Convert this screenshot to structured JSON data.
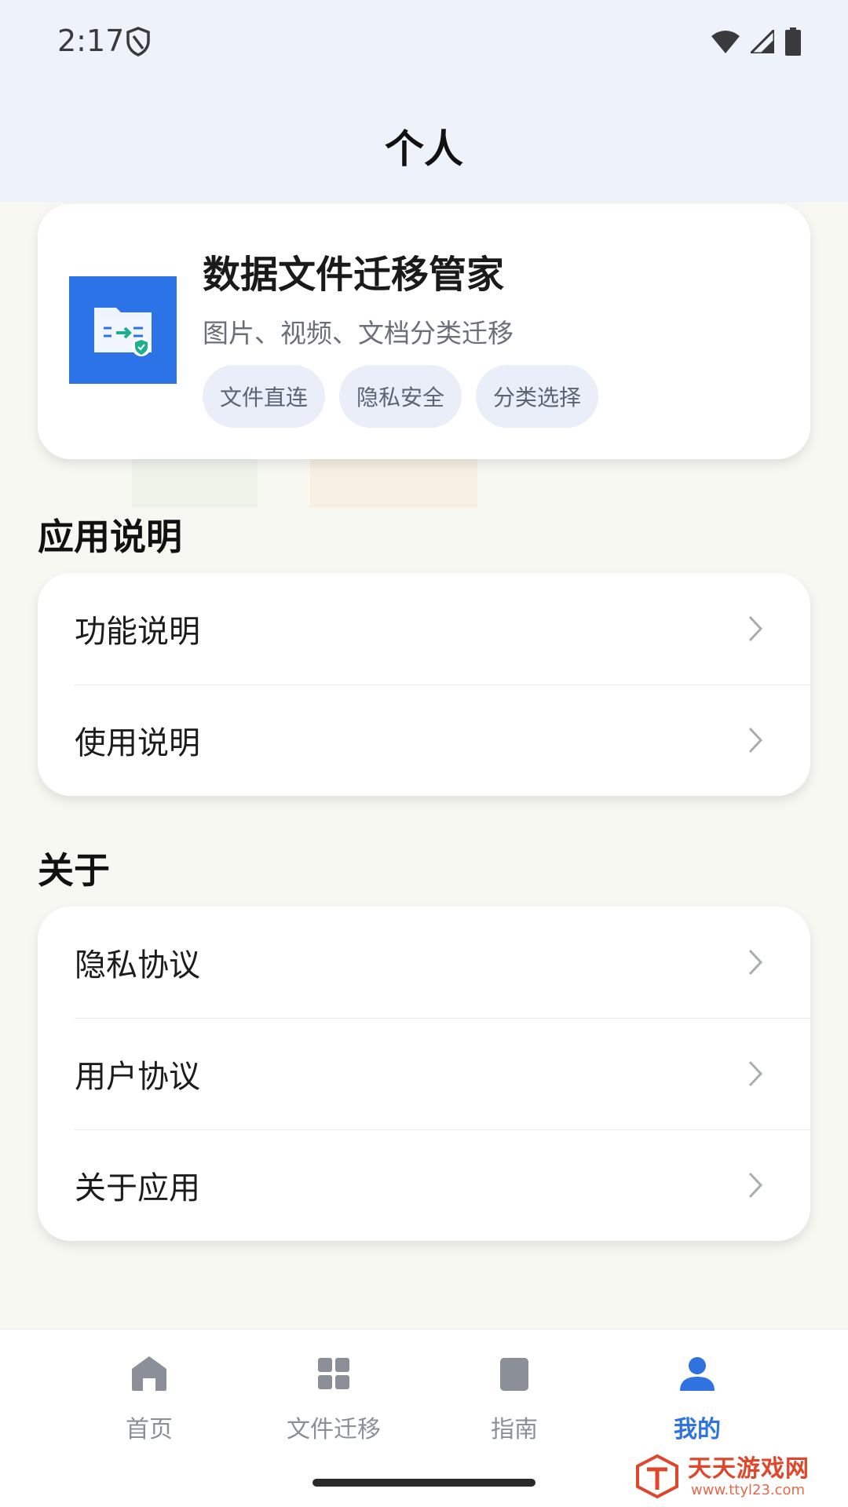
{
  "status_bar": {
    "time": "2:17"
  },
  "header": {
    "title": "个人"
  },
  "profile": {
    "app_name": "数据文件迁移管家",
    "description": "图片、视频、文档分类迁移",
    "tags": [
      "文件直连",
      "隐私安全",
      "分类选择"
    ]
  },
  "sections": [
    {
      "title": "应用说明",
      "items": [
        "功能说明",
        "使用说明"
      ]
    },
    {
      "title": "关于",
      "items": [
        "隐私协议",
        "用户协议",
        "关于应用"
      ]
    }
  ],
  "bottom_nav": {
    "items": [
      {
        "label": "首页",
        "icon": "home-icon"
      },
      {
        "label": "文件迁移",
        "icon": "grid-icon"
      },
      {
        "label": "指南",
        "icon": "book-icon"
      },
      {
        "label": "我的",
        "icon": "person-icon"
      }
    ],
    "active_index": 3
  },
  "watermark": {
    "title": "天天游戏网",
    "url": "www.ttyl23.com"
  },
  "colors": {
    "accent": "#2f73e0",
    "header_bg": "#eef2fb",
    "page_bg": "#f8f8f3",
    "tag_bg": "#e9eef9",
    "logo_bg": "#2c73e8"
  }
}
